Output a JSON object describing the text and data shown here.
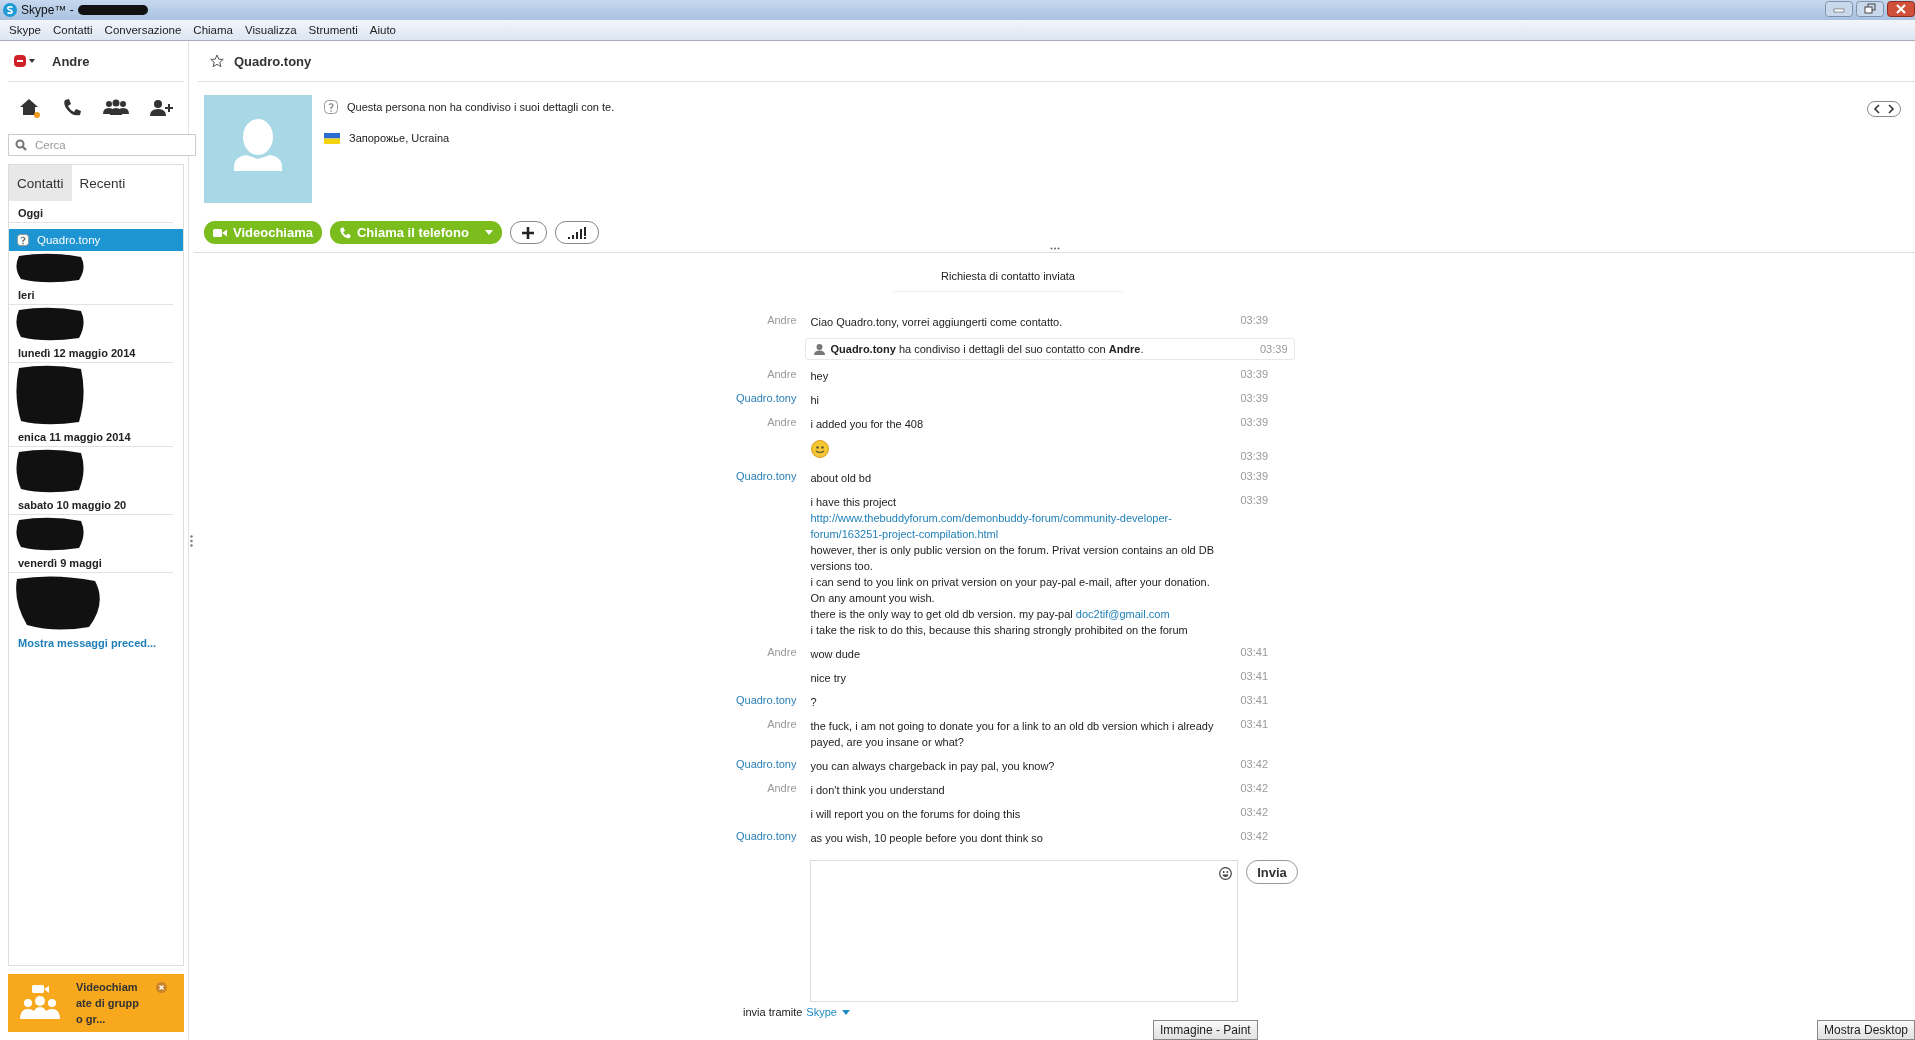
{
  "window": {
    "title": "Skype™ -"
  },
  "menu": [
    "Skype",
    "Contatti",
    "Conversazione",
    "Chiama",
    "Visualizza",
    "Strumenti",
    "Aiuto"
  ],
  "sidebar": {
    "user": "Andre",
    "search": {
      "placeholder": "Cerca"
    },
    "tabs": [
      {
        "label": "Contatti",
        "selected": true
      },
      {
        "label": "Recenti",
        "selected": false
      }
    ],
    "groups": [
      {
        "heading": "Oggi",
        "contacts": [
          {
            "name": "Quadro.tony",
            "selected": true
          }
        ]
      },
      {
        "heading": "Ieri"
      },
      {
        "heading": "lunedì 12 maggio 2014"
      },
      {
        "heading": "enica 11 maggio 2014"
      },
      {
        "heading": "sabato 10 maggio 20"
      },
      {
        "heading": "venerdì 9 maggi"
      }
    ],
    "more_link": "Mostra messaggi preced...",
    "promo": "Videochiamate di gruppo gr..."
  },
  "contact": {
    "name": "Quadro.tony",
    "note": "Questa persona non ha condiviso i suoi dettagli con te.",
    "location": "Запорожье, Ucraina",
    "buttons": [
      {
        "kind": "video",
        "label": "Videochiama"
      },
      {
        "kind": "phone",
        "label": "Chiama il telefono"
      },
      {
        "kind": "add"
      },
      {
        "kind": "signal"
      }
    ]
  },
  "chat": {
    "notice": "Richiesta di contatto inviata",
    "rows": [
      {
        "kind": "message",
        "sender": "Andre",
        "outgoing": true,
        "paragraphs": [
          [
            {
              "text": "Ciao Quadro.tony, vorrei aggiungerti come contatto."
            }
          ]
        ],
        "time": "03:39"
      },
      {
        "kind": "system",
        "text": "**Quadro.tony** ha condiviso i dettagli del suo contatto con **Andre**.",
        "time": "03:39"
      },
      {
        "kind": "message",
        "sender": "Andre",
        "outgoing": true,
        "paragraphs": [
          [
            {
              "text": "hey"
            }
          ]
        ],
        "time": "03:39"
      },
      {
        "kind": "message",
        "sender": "Quadro.tony",
        "outgoing": false,
        "paragraphs": [
          [
            {
              "text": "hi"
            }
          ]
        ],
        "time": "03:39"
      },
      {
        "kind": "message",
        "sender": "Andre",
        "outgoing": true,
        "paragraphs": [
          [
            {
              "text": "i added you for the 408"
            }
          ]
        ],
        "time": "03:39"
      },
      {
        "kind": "emoji",
        "time": "03:39"
      },
      {
        "kind": "message",
        "sender": "Quadro.tony",
        "outgoing": false,
        "paragraphs": [
          [
            {
              "text": "about old bd"
            }
          ]
        ],
        "time": "03:39"
      },
      {
        "kind": "message",
        "paragraphs": [
          [
            {
              "text": "i have this project"
            }
          ],
          [
            {
              "text": "http://www.thebuddyforum.com/demonbuddy-forum/community-developer-forum/163251-project-compilation.html",
              "link": true
            }
          ],
          [
            {
              "text": "however, ther is only public version on the forum. Privat version contains an old DB versions too."
            }
          ],
          [
            {
              "text": "i can send to you link on privat version on your pay-pal e-mail, after your donation. On any amount you wish."
            }
          ],
          [
            {
              "text": "there is the only way to get old db version. my pay-pal "
            },
            {
              "text": "doc2tif@gmail.com",
              "link": true
            }
          ],
          [
            {
              "text": "i take the risk to do this, because this sharing strongly prohibited on the forum"
            }
          ]
        ],
        "time": "03:39"
      },
      {
        "kind": "message",
        "sender": "Andre",
        "outgoing": true,
        "paragraphs": [
          [
            {
              "text": "wow dude"
            }
          ]
        ],
        "time": "03:41"
      },
      {
        "kind": "message",
        "paragraphs": [
          [
            {
              "text": "nice try"
            }
          ]
        ],
        "time": "03:41"
      },
      {
        "kind": "message",
        "sender": "Quadro.tony",
        "outgoing": false,
        "paragraphs": [
          [
            {
              "text": "?"
            }
          ]
        ],
        "time": "03:41"
      },
      {
        "kind": "message",
        "sender": "Andre",
        "outgoing": true,
        "paragraphs": [
          [
            {
              "text": "the fuck, i am not going to donate you for a link to an old db version which i already payed, are you insane or what?"
            }
          ]
        ],
        "time": "03:41"
      },
      {
        "kind": "message",
        "sender": "Quadro.tony",
        "outgoing": false,
        "paragraphs": [
          [
            {
              "text": "you can always chargeback in pay pal, you know?"
            }
          ]
        ],
        "time": "03:42"
      },
      {
        "kind": "message",
        "sender": "Andre",
        "outgoing": true,
        "paragraphs": [
          [
            {
              "text": "i don't think you understand"
            }
          ]
        ],
        "time": "03:42"
      },
      {
        "kind": "message",
        "paragraphs": [
          [
            {
              "text": "i will report you on the forums for doing this"
            }
          ]
        ],
        "time": "03:42"
      },
      {
        "kind": "message",
        "sender": "Quadro.tony",
        "outgoing": false,
        "paragraphs": [
          [
            {
              "text": "as you wish, 10 people before you dont think so"
            }
          ]
        ],
        "time": "03:42"
      }
    ],
    "send_button": "Invia",
    "send_via": "invia tramite",
    "send_via_service": "Skype"
  },
  "taskbar": [
    {
      "label": "Immagine - Paint"
    },
    {
      "label": "Mostra Desktop"
    }
  ]
}
